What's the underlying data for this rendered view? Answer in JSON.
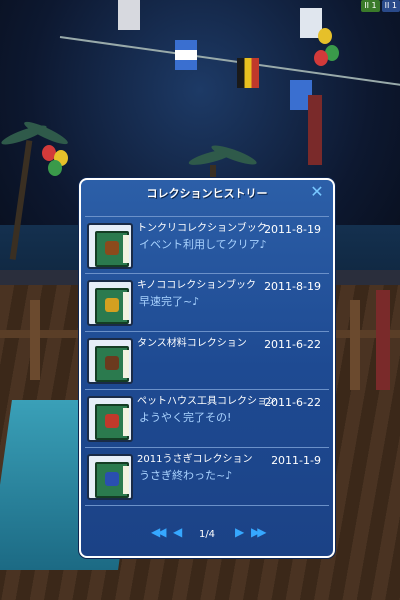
{
  "hud": {
    "badge1": "II 1",
    "badge2": "II 1"
  },
  "window": {
    "title": "コレクションヒストリー",
    "close_label": "✕",
    "entries": [
      {
        "name": "トンクリコレクションブック",
        "date": "2011-8-19",
        "comment": "イベント利用してクリア♪",
        "item_color": "#8b4a1c"
      },
      {
        "name": "キノココレクションブック",
        "date": "2011-8-19",
        "comment": "早速完了~♪",
        "item_color": "#d4a020"
      },
      {
        "name": "タンス材料コレクション",
        "date": "2011-6-22",
        "comment": "",
        "item_color": "#6b3a1e"
      },
      {
        "name": "ペットハウス工具コレクション",
        "date": "2011-6-22",
        "comment": "ようやく完了その!",
        "item_color": "#c0392b"
      },
      {
        "name": "2011うさぎコレクション",
        "date": "2011-1-9",
        "comment": "うさぎ終わった~♪",
        "item_color": "#2a4fb0"
      }
    ],
    "pager": {
      "first_label": "◀◀",
      "prev_label": "◀",
      "page": "1/4",
      "next_label": "▶",
      "last_label": "▶▶"
    }
  },
  "colors": {
    "window_bg": "#2c5fa8",
    "accent": "#36a8ff",
    "comment_text": "#a9d3ff"
  }
}
